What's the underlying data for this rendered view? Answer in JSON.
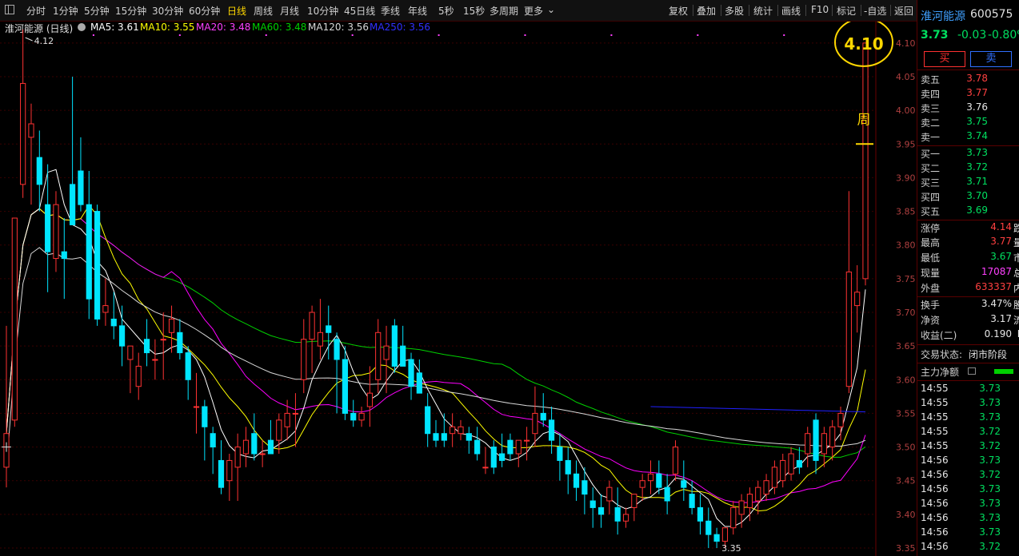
{
  "toolbar": {
    "left_icon": "layout-icon",
    "periods": [
      "分时",
      "1分钟",
      "5分钟",
      "15分钟",
      "30分钟",
      "60分钟",
      "日线",
      "周线",
      "月线",
      "10分钟",
      "45日线",
      "季线",
      "年线",
      "5秒",
      "15秒",
      "多周期",
      "更多"
    ],
    "active_period": "日线",
    "right_tools": [
      "复权",
      "叠加",
      "多股",
      "统计",
      "画线",
      "F10",
      "标记",
      "-自选",
      "返回"
    ]
  },
  "legend": {
    "title": "淮河能源 (日线)",
    "ma5": "MA5: 3.61",
    "ma10": "MA10: 3.55",
    "ma20": "MA20: 3.48",
    "ma60": "MA60: 3.48",
    "ma120": "MA120: 3.56",
    "ma250": "MA250: 3.56"
  },
  "colors": {
    "up": "#ff3232",
    "down": "#00e5ff",
    "ma5": "#ffffff",
    "ma10": "#ffff00",
    "ma20": "#ff00ff",
    "ma60": "#00d000",
    "ma120": "#d8d8d8",
    "ma250": "#2020ff",
    "annotation": "#ffd700"
  },
  "annotations": {
    "high_label": "4.12",
    "low_label": "3.35",
    "circle_price": "4.10",
    "week_label": "周"
  },
  "chart_data": {
    "type": "candlestick",
    "ylim": [
      3.35,
      4.12
    ],
    "y_ticks": [
      "4.10",
      "4.05",
      "4.00",
      "3.95",
      "3.90",
      "3.85",
      "3.80",
      "3.75",
      "3.70",
      "3.65",
      "3.60",
      "3.55",
      "3.50",
      "3.45",
      "3.40",
      "3.35"
    ],
    "candles": [
      [
        3.47,
        3.68,
        3.44,
        3.52
      ],
      [
        3.54,
        3.84,
        3.53,
        3.84
      ],
      [
        3.89,
        4.12,
        3.87,
        4.04
      ],
      [
        3.96,
        4.01,
        3.86,
        3.98
      ],
      [
        3.93,
        3.97,
        3.85,
        3.89
      ],
      [
        3.86,
        3.92,
        3.73,
        3.79
      ],
      [
        3.78,
        3.88,
        3.76,
        3.86
      ],
      [
        3.79,
        3.84,
        3.72,
        3.78
      ],
      [
        3.89,
        4.05,
        3.83,
        3.83
      ],
      [
        3.91,
        3.96,
        3.85,
        3.86
      ],
      [
        3.86,
        3.91,
        3.69,
        3.72
      ],
      [
        3.85,
        3.86,
        3.68,
        3.69
      ],
      [
        3.7,
        3.75,
        3.68,
        3.71
      ],
      [
        3.69,
        3.73,
        3.66,
        3.68
      ],
      [
        3.68,
        3.71,
        3.62,
        3.65
      ],
      [
        3.63,
        3.65,
        3.58,
        3.65
      ],
      [
        3.59,
        3.64,
        3.57,
        3.62
      ],
      [
        3.66,
        3.69,
        3.62,
        3.64
      ],
      [
        3.63,
        3.66,
        3.6,
        3.63
      ],
      [
        3.66,
        3.7,
        3.6,
        3.66
      ],
      [
        3.67,
        3.71,
        3.64,
        3.69
      ],
      [
        3.67,
        3.69,
        3.63,
        3.64
      ],
      [
        3.64,
        3.65,
        3.57,
        3.6
      ],
      [
        3.56,
        3.61,
        3.52,
        3.56
      ],
      [
        3.56,
        3.57,
        3.48,
        3.53
      ],
      [
        3.52,
        3.53,
        3.46,
        3.5
      ],
      [
        3.48,
        3.51,
        3.43,
        3.44
      ],
      [
        3.45,
        3.49,
        3.42,
        3.48
      ],
      [
        3.47,
        3.52,
        3.42,
        3.5
      ],
      [
        3.49,
        3.53,
        3.47,
        3.51
      ],
      [
        3.52,
        3.55,
        3.48,
        3.49
      ],
      [
        3.49,
        3.51,
        3.47,
        3.49
      ],
      [
        3.51,
        3.54,
        3.49,
        3.49
      ],
      [
        3.51,
        3.55,
        3.49,
        3.54
      ],
      [
        3.53,
        3.57,
        3.51,
        3.55
      ],
      [
        3.55,
        3.58,
        3.5,
        3.55
      ],
      [
        3.6,
        3.69,
        3.58,
        3.66
      ],
      [
        3.66,
        3.71,
        3.61,
        3.7
      ],
      [
        3.65,
        3.72,
        3.63,
        3.67
      ],
      [
        3.68,
        3.71,
        3.63,
        3.67
      ],
      [
        3.66,
        3.67,
        3.55,
        3.63
      ],
      [
        3.63,
        3.65,
        3.54,
        3.55
      ],
      [
        3.55,
        3.57,
        3.53,
        3.54
      ],
      [
        3.54,
        3.56,
        3.53,
        3.55
      ],
      [
        3.56,
        3.62,
        3.53,
        3.58
      ],
      [
        3.6,
        3.69,
        3.58,
        3.67
      ],
      [
        3.63,
        3.68,
        3.58,
        3.65
      ],
      [
        3.68,
        3.69,
        3.61,
        3.62
      ],
      [
        3.65,
        3.68,
        3.62,
        3.62
      ],
      [
        3.63,
        3.64,
        3.57,
        3.59
      ],
      [
        3.61,
        3.63,
        3.58,
        3.58
      ],
      [
        3.56,
        3.58,
        3.5,
        3.52
      ],
      [
        3.52,
        3.54,
        3.5,
        3.51
      ],
      [
        3.52,
        3.55,
        3.5,
        3.51
      ],
      [
        3.52,
        3.55,
        3.5,
        3.53
      ],
      [
        3.52,
        3.54,
        3.51,
        3.53
      ],
      [
        3.52,
        3.53,
        3.49,
        3.51
      ],
      [
        3.51,
        3.53,
        3.48,
        3.49
      ],
      [
        3.47,
        3.5,
        3.46,
        3.47
      ],
      [
        3.5,
        3.51,
        3.46,
        3.47
      ],
      [
        3.49,
        3.52,
        3.47,
        3.48
      ],
      [
        3.51,
        3.52,
        3.48,
        3.49
      ],
      [
        3.49,
        3.51,
        3.47,
        3.51
      ],
      [
        3.51,
        3.53,
        3.48,
        3.51
      ],
      [
        3.52,
        3.59,
        3.5,
        3.55
      ],
      [
        3.55,
        3.58,
        3.53,
        3.54
      ],
      [
        3.54,
        3.56,
        3.49,
        3.51
      ],
      [
        3.5,
        3.52,
        3.45,
        3.48
      ],
      [
        3.48,
        3.5,
        3.43,
        3.46
      ],
      [
        3.46,
        3.48,
        3.42,
        3.44
      ],
      [
        3.45,
        3.47,
        3.4,
        3.43
      ],
      [
        3.42,
        3.44,
        3.38,
        3.41
      ],
      [
        3.41,
        3.43,
        3.38,
        3.4
      ],
      [
        3.42,
        3.45,
        3.4,
        3.44
      ],
      [
        3.41,
        3.44,
        3.37,
        3.39
      ],
      [
        3.39,
        3.41,
        3.38,
        3.4
      ],
      [
        3.41,
        3.43,
        3.39,
        3.43
      ],
      [
        3.44,
        3.46,
        3.42,
        3.45
      ],
      [
        3.45,
        3.48,
        3.43,
        3.46
      ],
      [
        3.46,
        3.48,
        3.43,
        3.44
      ],
      [
        3.44,
        3.46,
        3.4,
        3.42
      ],
      [
        3.46,
        3.51,
        3.45,
        3.5
      ],
      [
        3.45,
        3.48,
        3.42,
        3.44
      ],
      [
        3.43,
        3.45,
        3.4,
        3.41
      ],
      [
        3.41,
        3.43,
        3.37,
        3.39
      ],
      [
        3.39,
        3.41,
        3.35,
        3.37
      ],
      [
        3.37,
        3.38,
        3.35,
        3.36
      ],
      [
        3.36,
        3.38,
        3.35,
        3.38
      ],
      [
        3.38,
        3.42,
        3.37,
        3.41
      ],
      [
        3.4,
        3.43,
        3.38,
        3.42
      ],
      [
        3.41,
        3.44,
        3.39,
        3.43
      ],
      [
        3.42,
        3.45,
        3.4,
        3.44
      ],
      [
        3.43,
        3.46,
        3.42,
        3.45
      ],
      [
        3.44,
        3.48,
        3.43,
        3.47
      ],
      [
        3.45,
        3.49,
        3.44,
        3.48
      ],
      [
        3.46,
        3.5,
        3.45,
        3.49
      ],
      [
        3.48,
        3.5,
        3.46,
        3.47
      ],
      [
        3.49,
        3.53,
        3.47,
        3.52
      ],
      [
        3.54,
        3.55,
        3.46,
        3.48
      ],
      [
        3.49,
        3.53,
        3.47,
        3.52
      ],
      [
        3.5,
        3.54,
        3.48,
        3.53
      ],
      [
        3.53,
        3.56,
        3.51,
        3.55
      ],
      [
        3.59,
        3.88,
        3.58,
        3.76
      ],
      [
        3.71,
        3.77,
        3.67,
        3.73
      ],
      [
        3.75,
        3.86,
        3.74,
        4.1
      ]
    ]
  },
  "stock": {
    "name": "淮河能源",
    "code": "600575",
    "price": "3.73",
    "change": "-0.03",
    "pct": "-0.80%",
    "buy_button": "买",
    "sell_button": "卖"
  },
  "asks": [
    {
      "label": "卖五",
      "price": "3.78"
    },
    {
      "label": "卖四",
      "price": "3.77"
    },
    {
      "label": "卖三",
      "price": "3.76"
    },
    {
      "label": "卖二",
      "price": "3.75"
    },
    {
      "label": "卖一",
      "price": "3.74"
    }
  ],
  "bids": [
    {
      "label": "买一",
      "price": "3.73"
    },
    {
      "label": "买二",
      "price": "3.72"
    },
    {
      "label": "买三",
      "price": "3.71"
    },
    {
      "label": "买四",
      "price": "3.70"
    },
    {
      "label": "买五",
      "price": "3.69"
    }
  ],
  "stats": [
    {
      "label": "涨停",
      "value": "4.14",
      "suffix": "跌"
    },
    {
      "label": "最高",
      "value": "3.77",
      "suffix": "量"
    },
    {
      "label": "最低",
      "value": "3.67",
      "suffix": "市"
    },
    {
      "label": "现量",
      "value": "17087",
      "suffix": "总"
    },
    {
      "label": "外盘",
      "value": "633337",
      "suffix": "内"
    }
  ],
  "stats2": [
    {
      "label": "换手",
      "value": "3.47%",
      "suffix": "股"
    },
    {
      "label": "净资",
      "value": "3.17",
      "suffix": "流"
    },
    {
      "label": "收益(二)",
      "value": "0.190",
      "suffix": "P"
    }
  ],
  "status": {
    "label": "交易状态:",
    "value": "闭市阶段"
  },
  "main_flow": {
    "label": "主力净额"
  },
  "ticks": [
    {
      "time": "14:55",
      "price": "3.73"
    },
    {
      "time": "14:55",
      "price": "3.73"
    },
    {
      "time": "14:55",
      "price": "3.73"
    },
    {
      "time": "14:55",
      "price": "3.72"
    },
    {
      "time": "14:55",
      "price": "3.72"
    },
    {
      "time": "14:56",
      "price": "3.73"
    },
    {
      "time": "14:56",
      "price": "3.72"
    },
    {
      "time": "14:56",
      "price": "3.73"
    },
    {
      "time": "14:56",
      "price": "3.73"
    },
    {
      "time": "14:56",
      "price": "3.73"
    },
    {
      "time": "14:56",
      "price": "3.73"
    },
    {
      "time": "14:56",
      "price": "3.72"
    }
  ]
}
